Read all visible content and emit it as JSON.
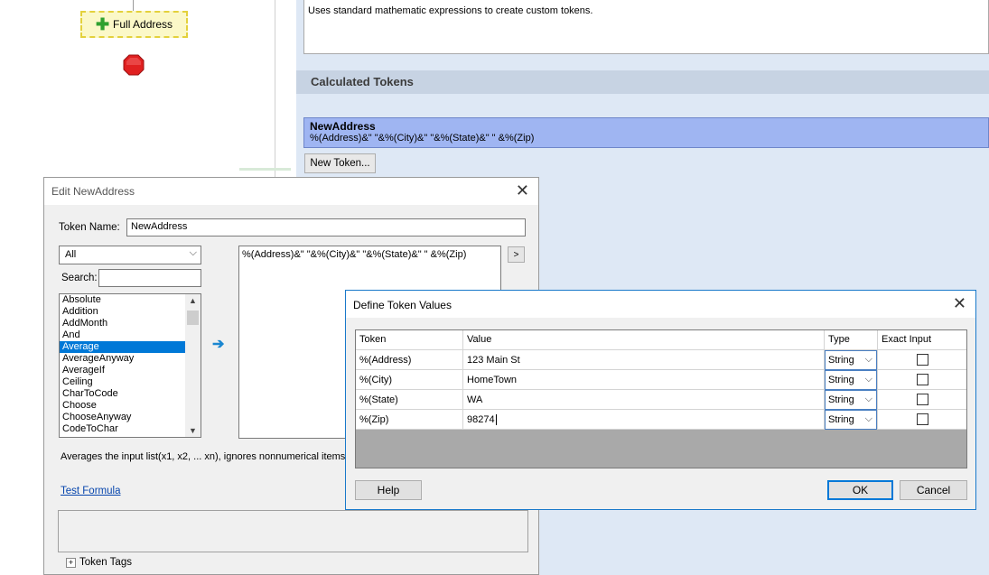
{
  "workflow": {
    "step_label": "Full Address",
    "step_icon": "plus-icon",
    "end_icon": "stop-icon"
  },
  "panel": {
    "description": "Uses standard mathematic expressions to create custom tokens.",
    "section_title": "Calculated Tokens",
    "token": {
      "name": "NewAddress",
      "formula": "%(Address)&\" \"&%(City)&\" \"&%(State)&\" \" &%(Zip)"
    },
    "new_token_label": "New Token..."
  },
  "edit_dialog": {
    "title": "Edit NewAddress",
    "token_name_label": "Token Name:",
    "token_name_value": "NewAddress",
    "category_selected": "All",
    "search_label": "Search:",
    "search_value": "",
    "functions": [
      "Absolute",
      "Addition",
      "AddMonth",
      "And",
      "Average",
      "AverageAnyway",
      "AverageIf",
      "Ceiling",
      "CharToCode",
      "Choose",
      "ChooseAnyway",
      "CodeToChar"
    ],
    "selected_function": "Average",
    "formula": "%(Address)&\" \"&%(City)&\" \"&%(State)&\" \" &%(Zip)",
    "expand_label": ">",
    "function_description": "Averages the input list(x1, x2, ... xn), ignores nonnumerical items.",
    "test_formula_label": "Test Formula",
    "token_tags_label": "Token Tags",
    "token_tags_toggle": "+"
  },
  "define_dialog": {
    "title": "Define Token Values",
    "columns": [
      "Token",
      "Value",
      "Type",
      "Exact Input"
    ],
    "rows": [
      {
        "token": "%(Address)",
        "value": "123 Main St",
        "type": "String",
        "exact": false
      },
      {
        "token": "%(City)",
        "value": "HomeTown",
        "type": "String",
        "exact": false
      },
      {
        "token": "%(State)",
        "value": "WA",
        "type": "String",
        "exact": false
      },
      {
        "token": "%(Zip)",
        "value": "98274",
        "type": "String",
        "exact": false
      }
    ],
    "help_label": "Help",
    "ok_label": "OK",
    "cancel_label": "Cancel"
  },
  "colors": {
    "selection": "#0078d7",
    "token_highlight": "#9fb5f2",
    "panel_background": "#dee8f5",
    "step_border": "#e3d13c",
    "stop_red": "#e02020"
  }
}
